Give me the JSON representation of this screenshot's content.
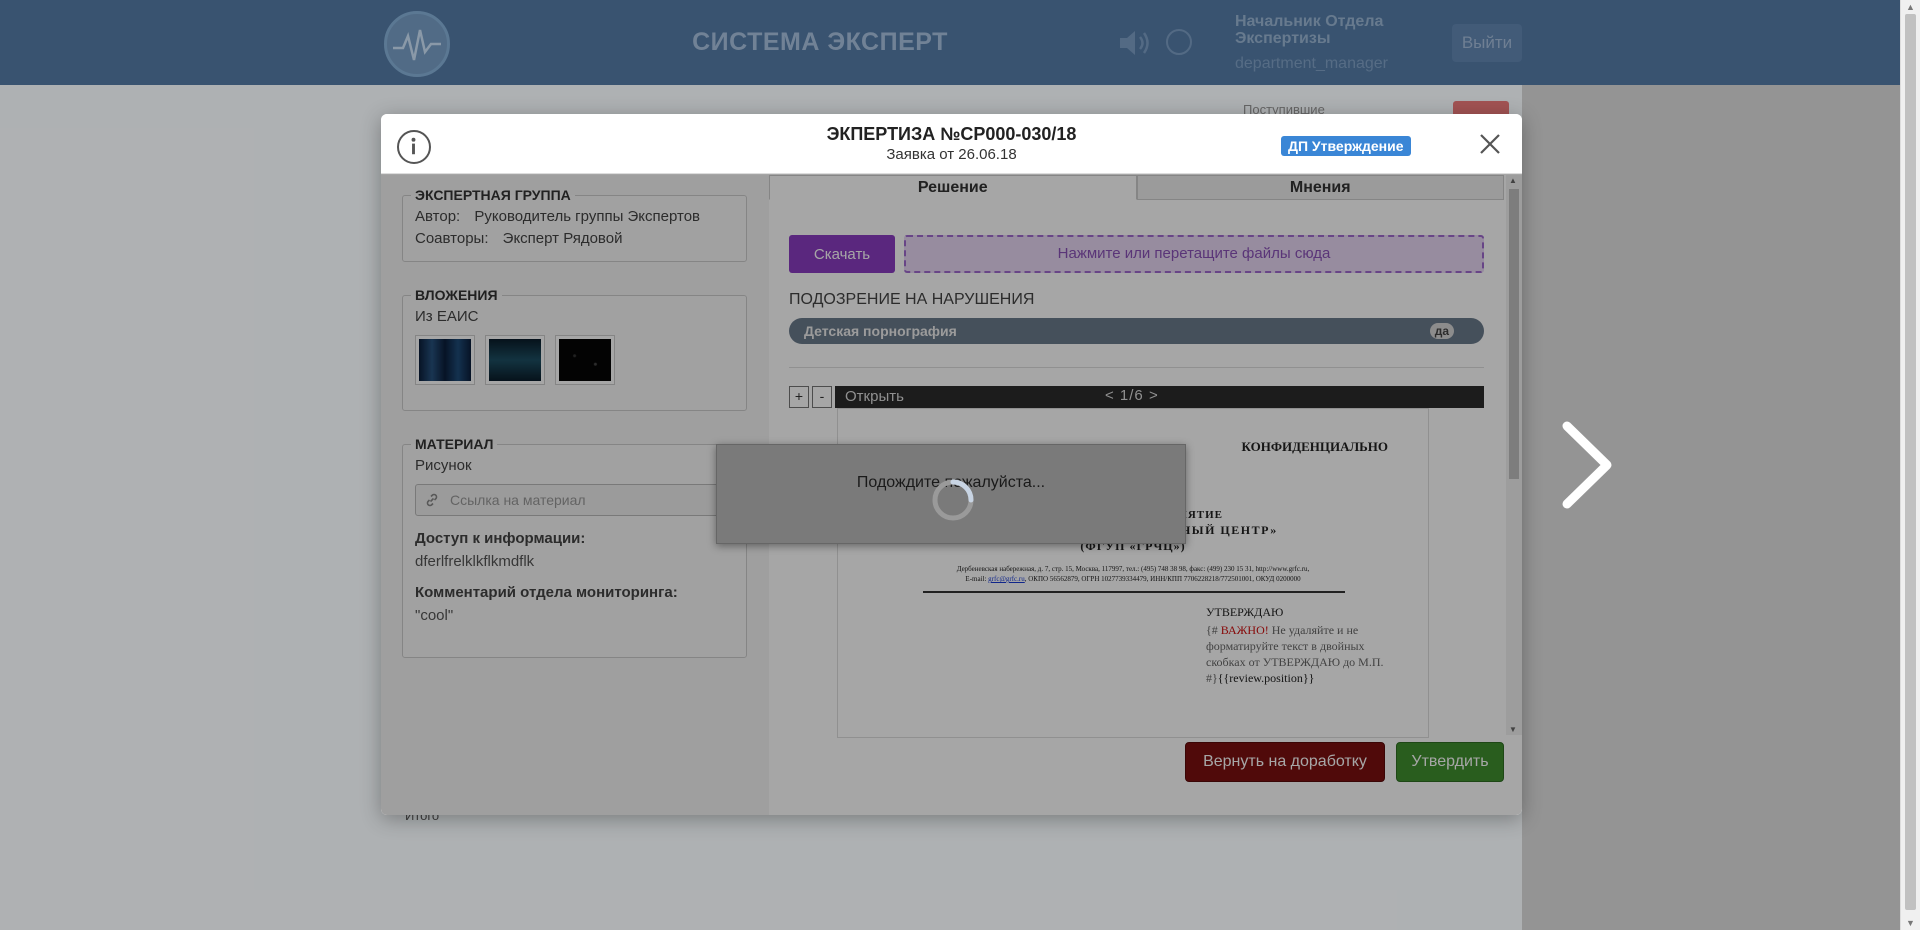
{
  "app": {
    "title": "СИСТЕМА ЭКСПЕРТ",
    "user_role": "Начальник Отдела Экспертизы",
    "user_login": "department_manager",
    "logout_label": "Выйти",
    "bg_label": "Поступившие",
    "bg_bottom_text": "Итого"
  },
  "modal": {
    "title": "ЭКПЕРТИЗА №СР000-030/18",
    "subtitle": "Заявка от 26.06.18",
    "status_badge": "ДП Утверждение",
    "status_color": "#3a86d6",
    "expert_group": {
      "legend": "ЭКСПЕРТНАЯ ГРУППА",
      "author_key": "Автор:",
      "author_value": "Руководитель группы Экспертов",
      "coauthors_key": "Соавторы:",
      "coauthors_value": "Эксперт Рядовой"
    },
    "attachments": {
      "legend": "ВЛОЖЕНИЯ",
      "source": "Из ЕАИС",
      "thumbnails": [
        "attachment-1",
        "attachment-2",
        "attachment-3"
      ]
    },
    "material": {
      "legend": "МАТЕРИАЛ",
      "type": "Рисунок",
      "link_placeholder": "Ссылка на материал",
      "access_label": "Доступ к информации:",
      "access_value": "dferlfrelklkflkmdflk",
      "comment_label": "Комментарий отдела мониторинга:",
      "comment_value": "\"cool\""
    },
    "tabs": [
      {
        "label": "Решение",
        "active": true
      },
      {
        "label": "Мнения",
        "active": false
      }
    ],
    "download_label": "Скачать",
    "dropzone_label": "Нажмите или перетащите файлы сюда",
    "suspicion_title": "ПОДОЗРЕНИЕ НА НАРУШЕНИЯ",
    "suspicion_item": "Детская порнография",
    "suspicion_value": "да",
    "viewer": {
      "zoom_in": "+",
      "zoom_out": "-",
      "open_label": "Открыть",
      "pager": "<  1/6  >"
    },
    "document": {
      "confidential": "КОНФИДЕНЦИАЛЬНО",
      "line1": "УНИТАРНОЕ ПРЕДПРИЯТИЕ",
      "line2": "«ГЛАВНЫЙ РАДИОЧАСТОТНЫЙ ЦЕНТР»",
      "line3": "(ФГУП «ГРЧЦ»)",
      "address1": "Дербеневская набережная, д. 7, стр. 15, Москва, 117997, тел.: (495) 748 38 98, факс: (499) 230 15 31, http://www.grfc.ru,",
      "address2_pre": "E-mail: ",
      "address2_mail": "grfc@grfc.ru",
      "address2_post": ", ОКПО 56562879, ОГРН 1027739334479, ИНН/КПП 7706228218/772501001, ОКУД 0200000",
      "approve": "УТВЕРЖДАЮ",
      "warning_open": "{# ",
      "warning_red": "ВАЖНО!",
      "warning_text": " Не удаляйте и не форматируйте текст в двойных скобках от УТВЕРЖДАЮ до М.П. #}",
      "template_var": "{{review.position}}"
    },
    "return_label": "Вернуть на доработку",
    "approve_label": "Утвердить"
  },
  "loading": {
    "text": "Подождите пожалуйста..."
  },
  "colors": {
    "header_bg": "#4c6f96",
    "download_btn": "#8b3cc2",
    "return_btn": "#7b1010",
    "approve_btn": "#3f8f2f"
  }
}
